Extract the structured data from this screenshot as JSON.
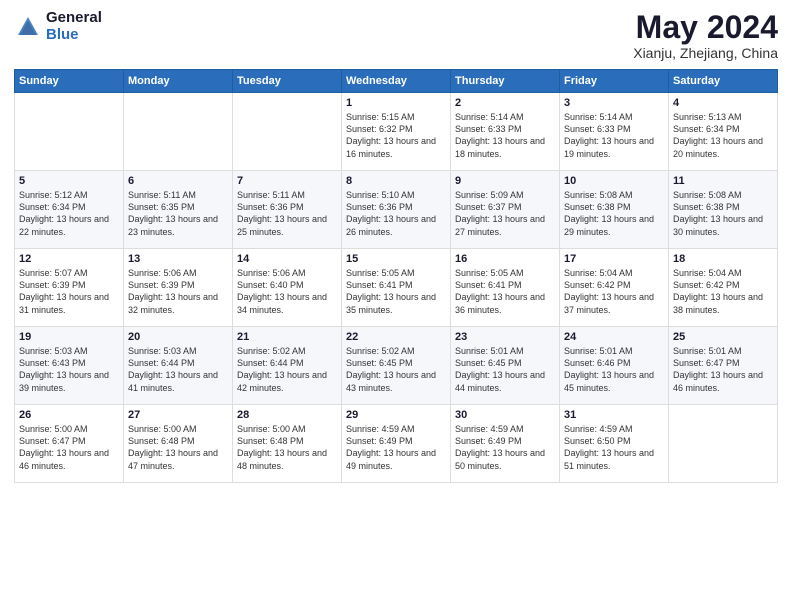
{
  "header": {
    "logo_general": "General",
    "logo_blue": "Blue",
    "month_title": "May 2024",
    "location": "Xianju, Zhejiang, China"
  },
  "weekdays": [
    "Sunday",
    "Monday",
    "Tuesday",
    "Wednesday",
    "Thursday",
    "Friday",
    "Saturday"
  ],
  "rows": [
    [
      {
        "day": "",
        "sunrise": "",
        "sunset": "",
        "daylight": ""
      },
      {
        "day": "",
        "sunrise": "",
        "sunset": "",
        "daylight": ""
      },
      {
        "day": "",
        "sunrise": "",
        "sunset": "",
        "daylight": ""
      },
      {
        "day": "1",
        "sunrise": "Sunrise: 5:15 AM",
        "sunset": "Sunset: 6:32 PM",
        "daylight": "Daylight: 13 hours and 16 minutes."
      },
      {
        "day": "2",
        "sunrise": "Sunrise: 5:14 AM",
        "sunset": "Sunset: 6:33 PM",
        "daylight": "Daylight: 13 hours and 18 minutes."
      },
      {
        "day": "3",
        "sunrise": "Sunrise: 5:14 AM",
        "sunset": "Sunset: 6:33 PM",
        "daylight": "Daylight: 13 hours and 19 minutes."
      },
      {
        "day": "4",
        "sunrise": "Sunrise: 5:13 AM",
        "sunset": "Sunset: 6:34 PM",
        "daylight": "Daylight: 13 hours and 20 minutes."
      }
    ],
    [
      {
        "day": "5",
        "sunrise": "Sunrise: 5:12 AM",
        "sunset": "Sunset: 6:34 PM",
        "daylight": "Daylight: 13 hours and 22 minutes."
      },
      {
        "day": "6",
        "sunrise": "Sunrise: 5:11 AM",
        "sunset": "Sunset: 6:35 PM",
        "daylight": "Daylight: 13 hours and 23 minutes."
      },
      {
        "day": "7",
        "sunrise": "Sunrise: 5:11 AM",
        "sunset": "Sunset: 6:36 PM",
        "daylight": "Daylight: 13 hours and 25 minutes."
      },
      {
        "day": "8",
        "sunrise": "Sunrise: 5:10 AM",
        "sunset": "Sunset: 6:36 PM",
        "daylight": "Daylight: 13 hours and 26 minutes."
      },
      {
        "day": "9",
        "sunrise": "Sunrise: 5:09 AM",
        "sunset": "Sunset: 6:37 PM",
        "daylight": "Daylight: 13 hours and 27 minutes."
      },
      {
        "day": "10",
        "sunrise": "Sunrise: 5:08 AM",
        "sunset": "Sunset: 6:38 PM",
        "daylight": "Daylight: 13 hours and 29 minutes."
      },
      {
        "day": "11",
        "sunrise": "Sunrise: 5:08 AM",
        "sunset": "Sunset: 6:38 PM",
        "daylight": "Daylight: 13 hours and 30 minutes."
      }
    ],
    [
      {
        "day": "12",
        "sunrise": "Sunrise: 5:07 AM",
        "sunset": "Sunset: 6:39 PM",
        "daylight": "Daylight: 13 hours and 31 minutes."
      },
      {
        "day": "13",
        "sunrise": "Sunrise: 5:06 AM",
        "sunset": "Sunset: 6:39 PM",
        "daylight": "Daylight: 13 hours and 32 minutes."
      },
      {
        "day": "14",
        "sunrise": "Sunrise: 5:06 AM",
        "sunset": "Sunset: 6:40 PM",
        "daylight": "Daylight: 13 hours and 34 minutes."
      },
      {
        "day": "15",
        "sunrise": "Sunrise: 5:05 AM",
        "sunset": "Sunset: 6:41 PM",
        "daylight": "Daylight: 13 hours and 35 minutes."
      },
      {
        "day": "16",
        "sunrise": "Sunrise: 5:05 AM",
        "sunset": "Sunset: 6:41 PM",
        "daylight": "Daylight: 13 hours and 36 minutes."
      },
      {
        "day": "17",
        "sunrise": "Sunrise: 5:04 AM",
        "sunset": "Sunset: 6:42 PM",
        "daylight": "Daylight: 13 hours and 37 minutes."
      },
      {
        "day": "18",
        "sunrise": "Sunrise: 5:04 AM",
        "sunset": "Sunset: 6:42 PM",
        "daylight": "Daylight: 13 hours and 38 minutes."
      }
    ],
    [
      {
        "day": "19",
        "sunrise": "Sunrise: 5:03 AM",
        "sunset": "Sunset: 6:43 PM",
        "daylight": "Daylight: 13 hours and 39 minutes."
      },
      {
        "day": "20",
        "sunrise": "Sunrise: 5:03 AM",
        "sunset": "Sunset: 6:44 PM",
        "daylight": "Daylight: 13 hours and 41 minutes."
      },
      {
        "day": "21",
        "sunrise": "Sunrise: 5:02 AM",
        "sunset": "Sunset: 6:44 PM",
        "daylight": "Daylight: 13 hours and 42 minutes."
      },
      {
        "day": "22",
        "sunrise": "Sunrise: 5:02 AM",
        "sunset": "Sunset: 6:45 PM",
        "daylight": "Daylight: 13 hours and 43 minutes."
      },
      {
        "day": "23",
        "sunrise": "Sunrise: 5:01 AM",
        "sunset": "Sunset: 6:45 PM",
        "daylight": "Daylight: 13 hours and 44 minutes."
      },
      {
        "day": "24",
        "sunrise": "Sunrise: 5:01 AM",
        "sunset": "Sunset: 6:46 PM",
        "daylight": "Daylight: 13 hours and 45 minutes."
      },
      {
        "day": "25",
        "sunrise": "Sunrise: 5:01 AM",
        "sunset": "Sunset: 6:47 PM",
        "daylight": "Daylight: 13 hours and 46 minutes."
      }
    ],
    [
      {
        "day": "26",
        "sunrise": "Sunrise: 5:00 AM",
        "sunset": "Sunset: 6:47 PM",
        "daylight": "Daylight: 13 hours and 46 minutes."
      },
      {
        "day": "27",
        "sunrise": "Sunrise: 5:00 AM",
        "sunset": "Sunset: 6:48 PM",
        "daylight": "Daylight: 13 hours and 47 minutes."
      },
      {
        "day": "28",
        "sunrise": "Sunrise: 5:00 AM",
        "sunset": "Sunset: 6:48 PM",
        "daylight": "Daylight: 13 hours and 48 minutes."
      },
      {
        "day": "29",
        "sunrise": "Sunrise: 4:59 AM",
        "sunset": "Sunset: 6:49 PM",
        "daylight": "Daylight: 13 hours and 49 minutes."
      },
      {
        "day": "30",
        "sunrise": "Sunrise: 4:59 AM",
        "sunset": "Sunset: 6:49 PM",
        "daylight": "Daylight: 13 hours and 50 minutes."
      },
      {
        "day": "31",
        "sunrise": "Sunrise: 4:59 AM",
        "sunset": "Sunset: 6:50 PM",
        "daylight": "Daylight: 13 hours and 51 minutes."
      },
      {
        "day": "",
        "sunrise": "",
        "sunset": "",
        "daylight": ""
      }
    ]
  ]
}
